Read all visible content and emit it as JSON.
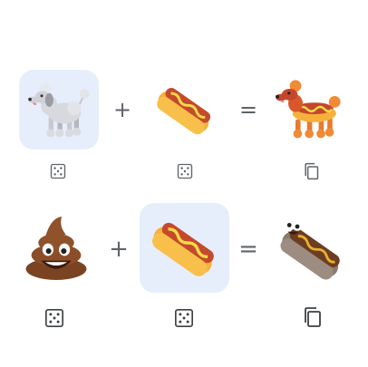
{
  "rows": [
    {
      "left_emoji": "poodle",
      "plus": "+",
      "right_emoji": "hot-dog",
      "equals": "=",
      "result_emoji": "poodle-hot-dog-mashup",
      "selected": "left"
    },
    {
      "left_emoji": "pile-of-poo",
      "plus": "+",
      "right_emoji": "hot-dog",
      "equals": "=",
      "result_emoji": "poo-hot-dog-mashup",
      "selected": "right"
    }
  ],
  "controls": {
    "randomize_icon": "dice-icon",
    "copy_icon": "copy-icon"
  },
  "colors": {
    "selected_tile": "#e6eefc",
    "operator": "#5f6368",
    "icon": "#5f6368"
  }
}
